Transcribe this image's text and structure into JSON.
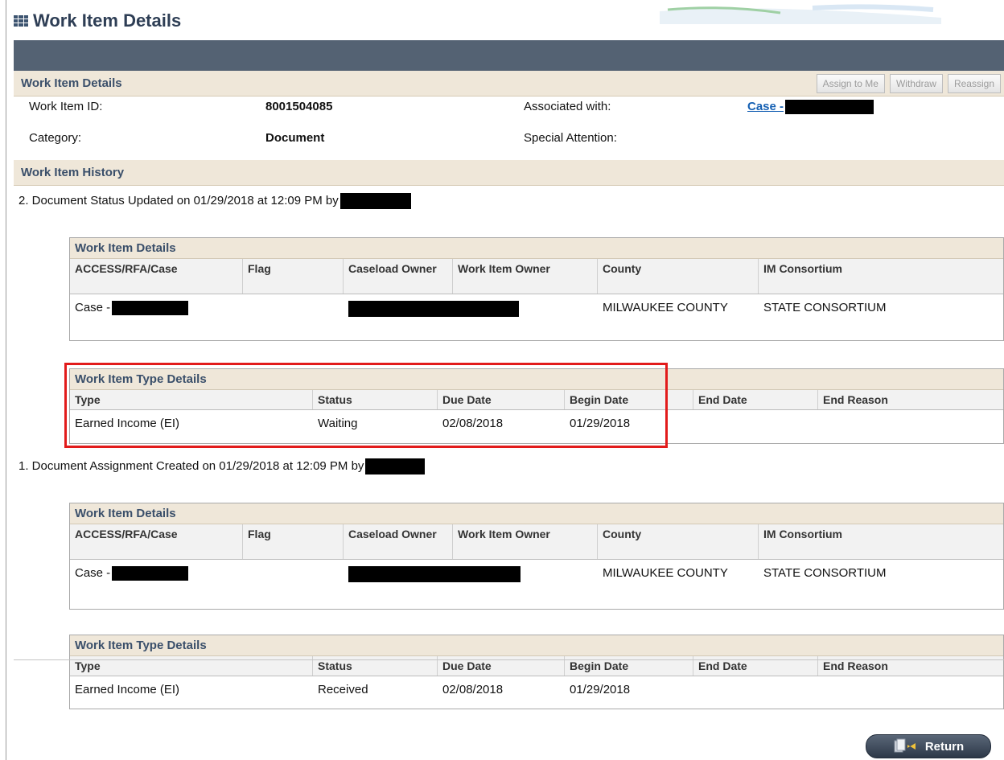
{
  "header": {
    "title": "Work Item Details",
    "icon": "grid-icon"
  },
  "details": {
    "section_title": "Work Item Details",
    "buttons": {
      "assign": "Assign to Me",
      "withdraw": "Withdraw",
      "reassign": "Reassign"
    },
    "work_item_id_label": "Work Item ID:",
    "work_item_id_value": "8001504085",
    "category_label": "Category:",
    "category_value": "Document",
    "associated_label": "Associated with:",
    "associated_value": "Case -",
    "special_label": "Special Attention:"
  },
  "history": {
    "section_title": "Work Item History",
    "entries": [
      {
        "line": "2. Document Status Updated on 01/29/2018 at 12:09 PM by",
        "wi_title": "Work Item Details",
        "wi_headers": [
          "ACCESS/RFA/Case",
          "Flag",
          "Caseload Owner",
          "Work Item Owner",
          "County",
          "IM Consortium"
        ],
        "wi_case": "Case -",
        "wi_county": "MILWAUKEE COUNTY",
        "wi_consortium": "STATE CONSORTIUM",
        "type_title": "Work Item Type Details",
        "type_headers": [
          "Type",
          "Status",
          "Due Date",
          "Begin Date",
          "End Date",
          "End Reason"
        ],
        "type_row": [
          "Earned Income (EI)",
          "Waiting",
          "02/08/2018",
          "01/29/2018",
          "",
          ""
        ]
      },
      {
        "line": "1. Document Assignment Created on 01/29/2018 at 12:09 PM by",
        "wi_title": "Work Item Details",
        "wi_headers": [
          "ACCESS/RFA/Case",
          "Flag",
          "Caseload Owner",
          "Work Item Owner",
          "County",
          "IM Consortium"
        ],
        "wi_case": "Case -",
        "wi_county": "MILWAUKEE COUNTY",
        "wi_consortium": "STATE CONSORTIUM",
        "type_title": "Work Item Type Details",
        "type_headers": [
          "Type",
          "Status",
          "Due Date",
          "Begin Date",
          "End Date",
          "End Reason"
        ],
        "type_row": [
          "Earned Income (EI)",
          "Received",
          "02/08/2018",
          "01/29/2018",
          "",
          ""
        ]
      }
    ]
  },
  "footer": {
    "return_label": "Return"
  },
  "colors": {
    "highlight": "#e21b1b",
    "header_bar": "#546273",
    "section_bg": "#efe7d9",
    "link": "#1560b3"
  }
}
